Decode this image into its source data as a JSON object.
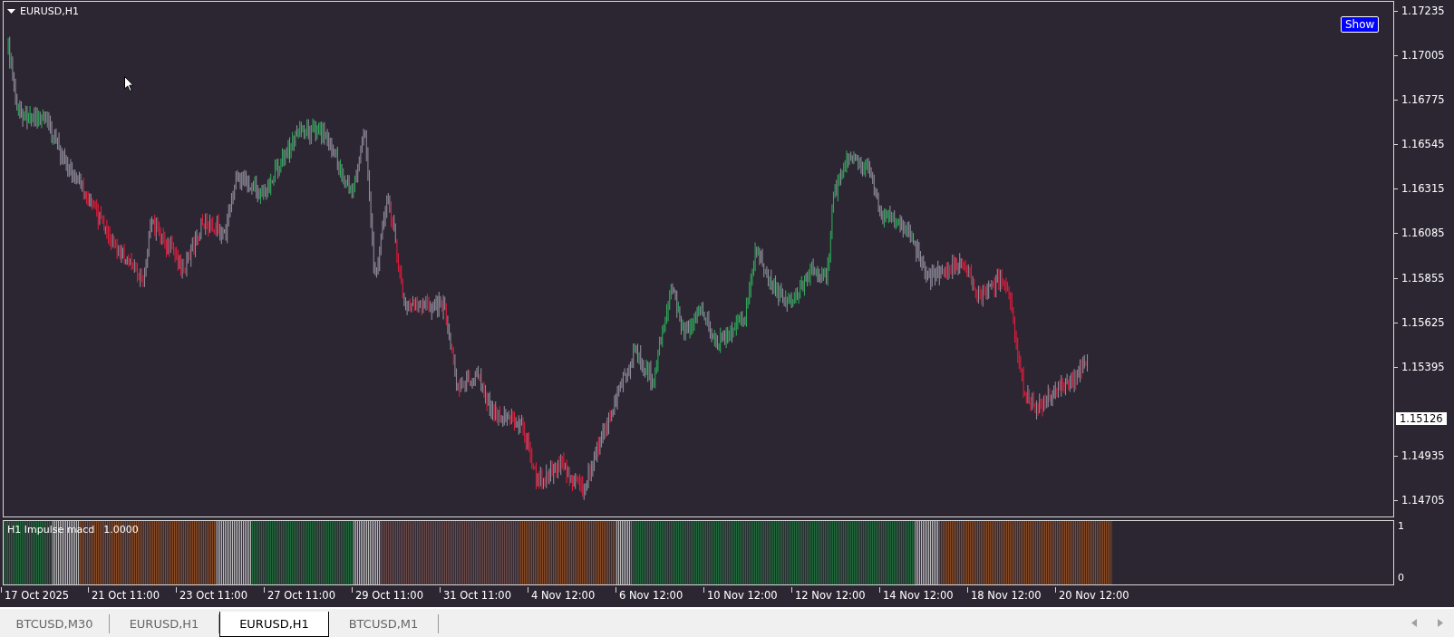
{
  "chart": {
    "symbol_label": "EURUSD,H1",
    "show_button": "Show",
    "price_axis": [
      "1.17235",
      "1.17005",
      "1.16775",
      "1.16545",
      "1.16315",
      "1.16085",
      "1.15855",
      "1.15625",
      "1.15395",
      "1.14935",
      "1.14705"
    ],
    "current_price": "1.15126"
  },
  "indicator": {
    "name": "H1 Impulse macd",
    "value": "1.0000",
    "axis": [
      "1",
      "0"
    ]
  },
  "time_axis": [
    "17 Oct 2025",
    "21 Oct 11:00",
    "23 Oct 11:00",
    "27 Oct 11:00",
    "29 Oct 11:00",
    "31 Oct 11:00",
    "4 Nov 12:00",
    "6 Nov 12:00",
    "10 Nov 12:00",
    "12 Nov 12:00",
    "14 Nov 12:00",
    "18 Nov 12:00",
    "20 Nov 12:00"
  ],
  "tabs": [
    {
      "label": "BTCUSD,M30",
      "selected": false
    },
    {
      "label": "EURUSD,H1",
      "selected": false
    },
    {
      "label": "EURUSD,H1",
      "selected": true
    },
    {
      "label": "BTCUSD,M1",
      "selected": false
    }
  ]
}
